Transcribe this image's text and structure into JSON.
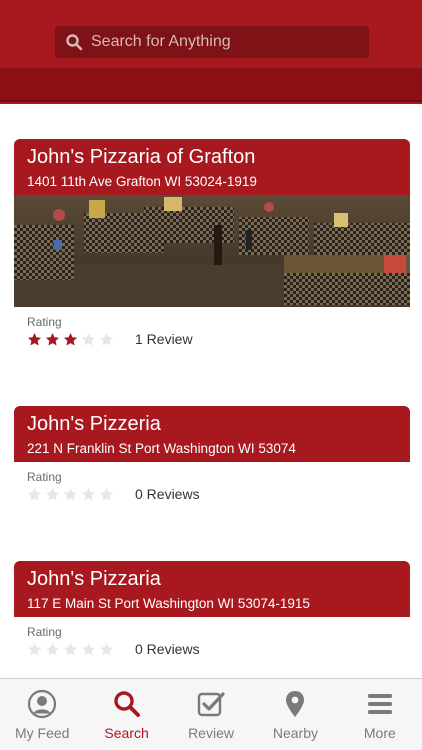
{
  "colors": {
    "brand": "#a8191f",
    "star_filled": "#a8191f",
    "star_empty": "#e6e6e6",
    "tab_inactive": "#7a7a7a"
  },
  "search": {
    "placeholder": "Search for Anything",
    "icon": "search-icon"
  },
  "listings": [
    {
      "name": "John's Pizzaria of Grafton",
      "address": "1401 11th Ave Grafton WI 53024-1919",
      "has_photo": true,
      "rating_label": "Rating",
      "stars": 3,
      "max_stars": 5,
      "reviews": "1 Review"
    },
    {
      "name": "John's Pizzeria",
      "address": "221 N Franklin St Port Washington WI 53074",
      "has_photo": false,
      "rating_label": "Rating",
      "stars": 0,
      "max_stars": 5,
      "reviews": "0 Reviews"
    },
    {
      "name": "John's Pizzaria",
      "address": "117 E Main St Port Washington WI 53074-1915",
      "has_photo": false,
      "rating_label": "Rating",
      "stars": 0,
      "max_stars": 5,
      "reviews": "0 Reviews"
    }
  ],
  "tabs": [
    {
      "label": "My Feed",
      "icon": "user-icon",
      "active": false
    },
    {
      "label": "Search",
      "icon": "search-icon",
      "active": true
    },
    {
      "label": "Review",
      "icon": "review-checkbox-icon",
      "active": false
    },
    {
      "label": "Nearby",
      "icon": "map-pin-icon",
      "active": false
    },
    {
      "label": "More",
      "icon": "menu-icon",
      "active": false
    }
  ]
}
